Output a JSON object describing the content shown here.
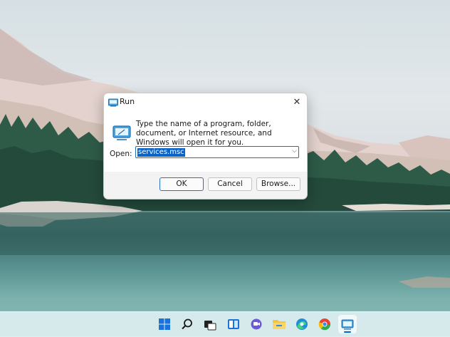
{
  "dialog": {
    "title": "Run",
    "description": "Type the name of a program, folder, document, or Internet resource, and Windows will open it for you.",
    "open_label": "Open:",
    "open_value": "services.msc",
    "buttons": {
      "ok": "OK",
      "cancel": "Cancel",
      "browse": "Browse..."
    }
  },
  "taskbar": {
    "icons": [
      "start-icon",
      "search-icon",
      "task-view-icon",
      "widgets-icon",
      "chat-icon",
      "file-explorer-icon",
      "edge-icon",
      "chrome-icon",
      "run-app-icon"
    ],
    "active": "run-app-icon",
    "accent": "#0a64c8"
  },
  "colors": {
    "accent": "#0a64c8",
    "dialog_bg": "#f3f3f3"
  }
}
